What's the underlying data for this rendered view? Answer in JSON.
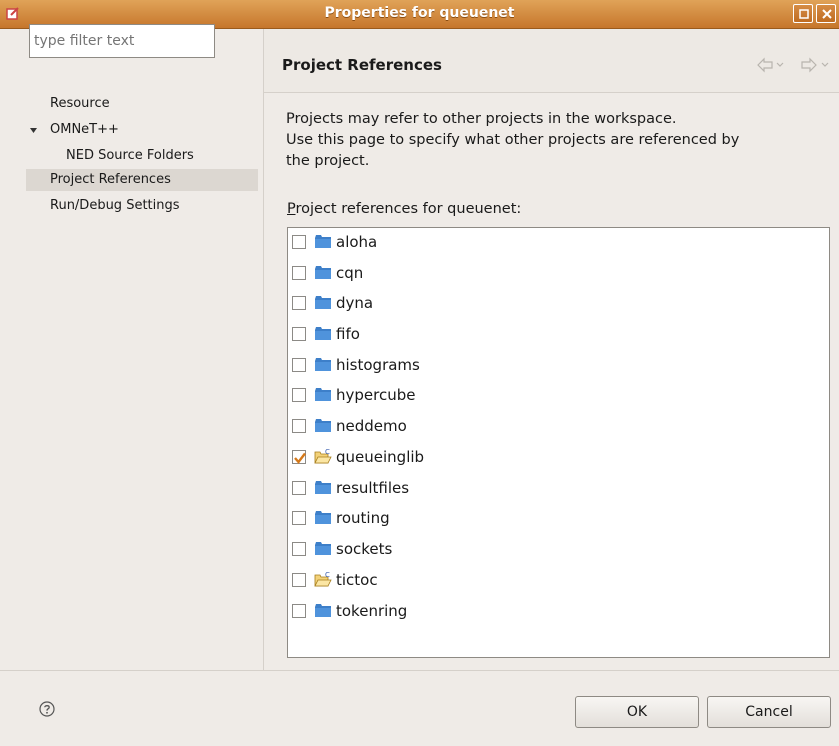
{
  "window": {
    "title": "Properties for queuenet",
    "maximize_icon": "maximize-icon",
    "close_icon": "close-icon"
  },
  "sidebar": {
    "filter_placeholder": "type filter text",
    "items": [
      {
        "label": "Resource",
        "selected": false
      },
      {
        "label": "OMNeT++",
        "selected": false,
        "expanded": true
      },
      {
        "label": "NED Source Folders",
        "selected": false
      },
      {
        "label": "Project References",
        "selected": true
      },
      {
        "label": "Run/Debug Settings",
        "selected": false
      }
    ]
  },
  "page": {
    "title": "Project References",
    "description": [
      "Projects may refer to other projects in the workspace.",
      "Use this page to specify what other projects are referenced by",
      "the project."
    ],
    "refs_label_prefix": "P",
    "refs_label_rest": "roject references for queuenet:",
    "projects": [
      {
        "name": "aloha",
        "checked": false,
        "icon": "folder-icon"
      },
      {
        "name": "cqn",
        "checked": false,
        "icon": "folder-icon"
      },
      {
        "name": "dyna",
        "checked": false,
        "icon": "folder-icon"
      },
      {
        "name": "fifo",
        "checked": false,
        "icon": "folder-icon"
      },
      {
        "name": "histograms",
        "checked": false,
        "icon": "folder-icon"
      },
      {
        "name": "hypercube",
        "checked": false,
        "icon": "folder-icon"
      },
      {
        "name": "neddemo",
        "checked": false,
        "icon": "folder-icon"
      },
      {
        "name": "queueinglib",
        "checked": true,
        "icon": "open-c-project-icon"
      },
      {
        "name": "resultfiles",
        "checked": false,
        "icon": "folder-icon"
      },
      {
        "name": "routing",
        "checked": false,
        "icon": "folder-icon"
      },
      {
        "name": "sockets",
        "checked": false,
        "icon": "folder-icon"
      },
      {
        "name": "tictoc",
        "checked": false,
        "icon": "open-c-project-icon"
      },
      {
        "name": "tokenring",
        "checked": false,
        "icon": "folder-icon"
      }
    ]
  },
  "buttons": {
    "ok": "OK",
    "cancel": "Cancel"
  },
  "colors": {
    "titlebar": "#c6762c",
    "checkmark": "#d4781a",
    "folder": "#3d7fc9"
  }
}
